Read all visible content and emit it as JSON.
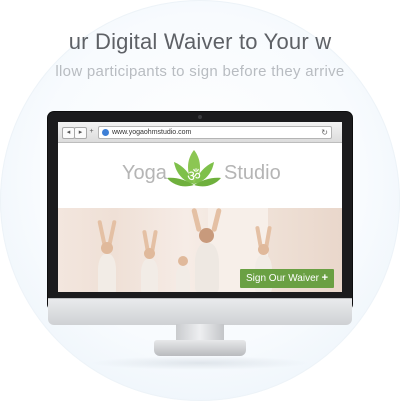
{
  "hero": {
    "headline": "ur Digital Waiver to Your w",
    "subline": "llow participants to sign before they arrive"
  },
  "browser": {
    "back_glyph": "◂",
    "forward_glyph": "▸",
    "add_glyph": "+",
    "url": "www.yogaohmstudio.com",
    "reload_glyph": "↻"
  },
  "site": {
    "brand_left": "Yoga",
    "brand_right": "Studio",
    "cta_label": "Sign Our Waiver",
    "cta_plus": "+"
  },
  "colors": {
    "accent_green": "#6aa043",
    "lotus_green": "#7ec04a",
    "headline_gray": "#5e6166"
  },
  "icons": [
    "lotus-om-logo-icon",
    "globe-icon",
    "reload-icon",
    "back-icon",
    "forward-icon",
    "add-tab-icon"
  ]
}
